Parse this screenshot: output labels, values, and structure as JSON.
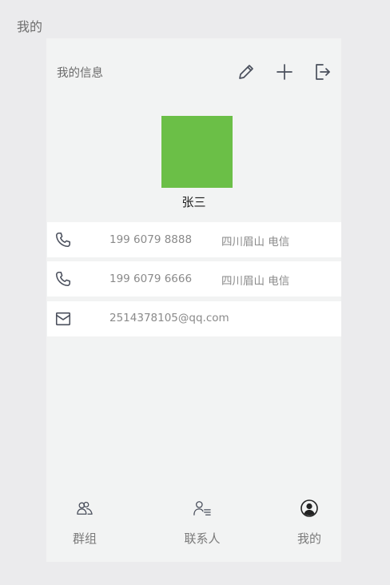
{
  "page": {
    "title": "我的"
  },
  "header": {
    "title": "我的信息",
    "actions": [
      {
        "name": "edit-icon"
      },
      {
        "name": "add-icon"
      },
      {
        "name": "logout-icon"
      }
    ]
  },
  "profile": {
    "avatar_color": "#6bbf47",
    "name": "张三"
  },
  "contacts": [
    {
      "icon": "phone-icon",
      "value": "199 6079 8888",
      "location": "四川眉山 电信"
    },
    {
      "icon": "phone-icon",
      "value": "199 6079 6666",
      "location": "四川眉山 电信"
    },
    {
      "icon": "mail-icon",
      "value": "2514378105@qq.com"
    }
  ],
  "tabs": [
    {
      "icon": "group-icon",
      "label": "群组"
    },
    {
      "icon": "contacts-icon",
      "label": "联系人"
    },
    {
      "icon": "profile-icon",
      "label": "我的"
    }
  ],
  "colors": {
    "background": "#ebebed",
    "panel": "#f2f3f3",
    "icon": "#4a4f5c"
  }
}
